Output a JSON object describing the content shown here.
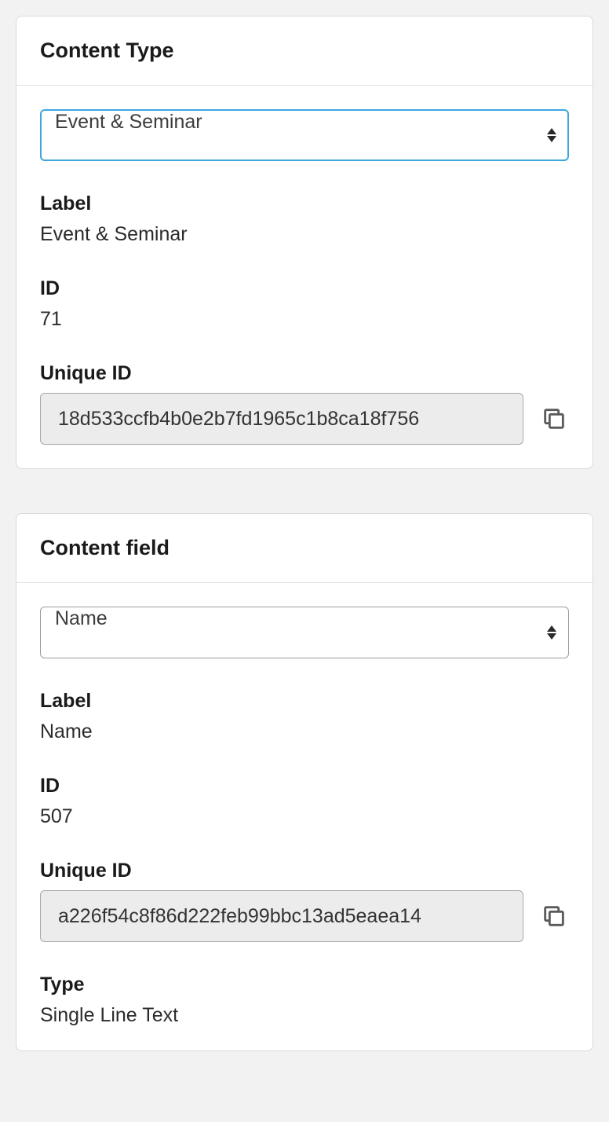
{
  "contentType": {
    "cardTitle": "Content Type",
    "selectValue": "Event & Seminar",
    "labelHeading": "Label",
    "labelValue": "Event & Seminar",
    "idHeading": "ID",
    "idValue": "71",
    "uniqueIdHeading": "Unique ID",
    "uniqueIdValue": "18d533ccfb4b0e2b7fd1965c1b8ca18f756"
  },
  "contentField": {
    "cardTitle": "Content field",
    "selectValue": "Name",
    "labelHeading": "Label",
    "labelValue": "Name",
    "idHeading": "ID",
    "idValue": "507",
    "uniqueIdHeading": "Unique ID",
    "uniqueIdValue": "a226f54c8f86d222feb99bbc13ad5eaea14",
    "typeHeading": "Type",
    "typeValue": "Single Line Text"
  }
}
